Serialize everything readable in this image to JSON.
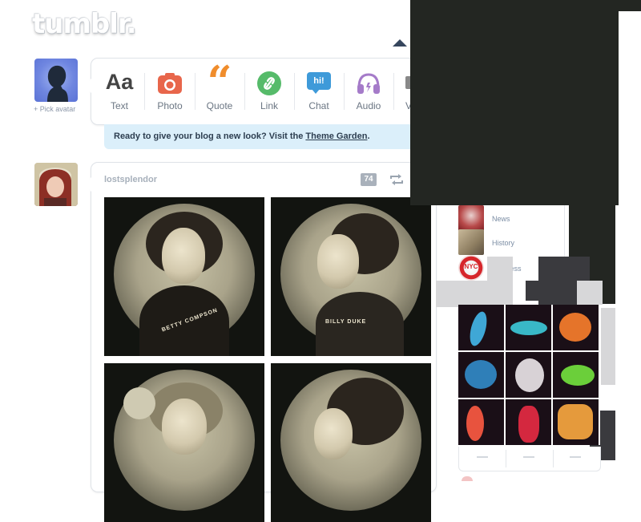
{
  "logo": {
    "text": "tumblr."
  },
  "avatar": {
    "pick_label": "+ Pick avatar"
  },
  "post_types": [
    {
      "label": "Text",
      "icon": "text-icon",
      "glyph": "Aa",
      "color": "#444444"
    },
    {
      "label": "Photo",
      "icon": "camera-icon",
      "color": "#e8664b"
    },
    {
      "label": "Quote",
      "icon": "quote-icon",
      "glyph": "“",
      "color": "#f08d2c"
    },
    {
      "label": "Link",
      "icon": "link-icon",
      "color": "#56bb6a"
    },
    {
      "label": "Chat",
      "icon": "chat-icon",
      "glyph": "hi!",
      "color": "#3e9ad9"
    },
    {
      "label": "Audio",
      "icon": "headphones-icon",
      "color": "#a57bc9"
    },
    {
      "label": "V",
      "icon": "video-icon",
      "color": "#888888"
    }
  ],
  "notice": {
    "text": "Ready to give your blog a new look? Visit the ",
    "link": "Theme Garden",
    "end": "."
  },
  "post": {
    "author": "lostsplendor",
    "notes": "74",
    "photos": [
      {
        "caption": "BETTY COMPSON"
      },
      {
        "caption": "BILLY DUKE"
      },
      {
        "caption": ""
      },
      {
        "caption": ""
      }
    ]
  },
  "sidebar": {
    "items": [
      {
        "label": "News"
      },
      {
        "label": "History"
      },
      {
        "label": "Business",
        "badge": "NYC"
      }
    ]
  },
  "colors": {
    "bg": "#ffffff",
    "notice_bg": "#dbeffa",
    "navy": "#36465d",
    "dark_overlay": "#232622"
  }
}
